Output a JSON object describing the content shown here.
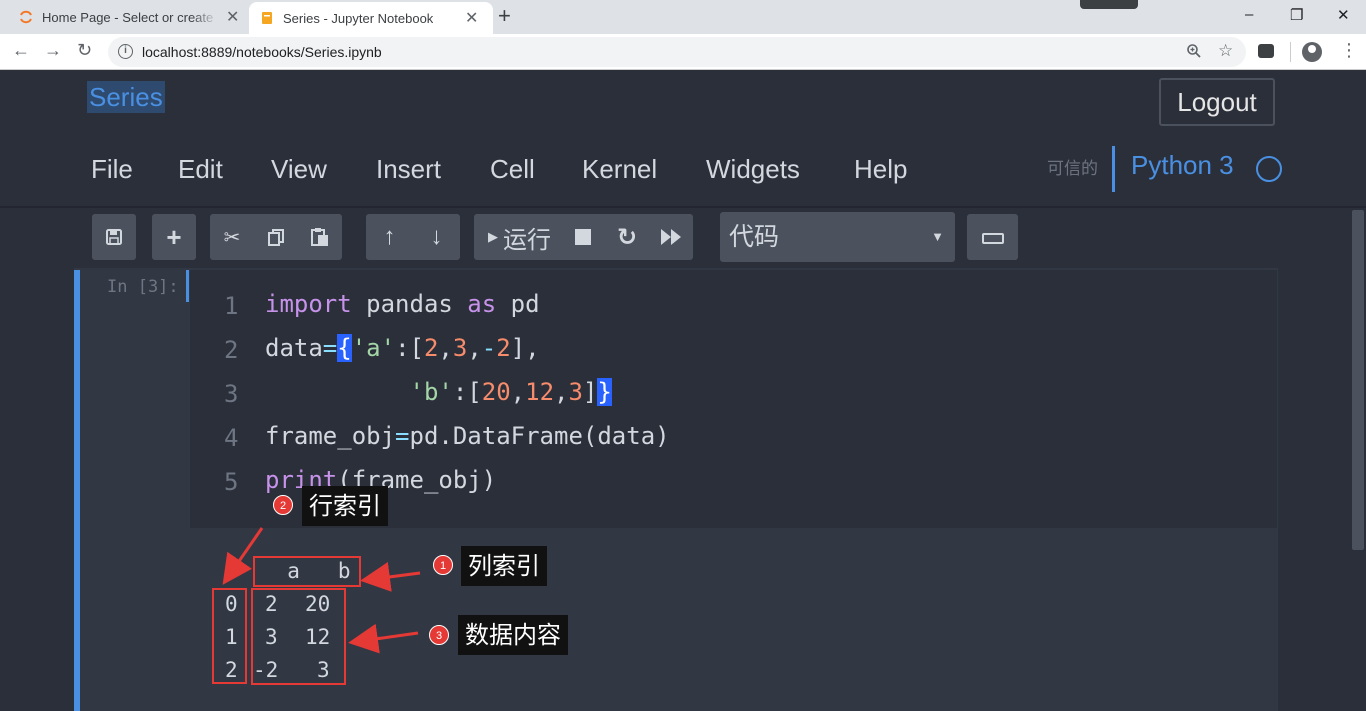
{
  "browser": {
    "tabs": [
      {
        "title": "Home Page - Select or create a notebook",
        "active": false
      },
      {
        "title": "Series - Jupyter Notebook",
        "active": true
      }
    ],
    "new_tab": "+",
    "url": "localhost:8889/notebooks/Series.ipynb",
    "window_controls": {
      "minimize": "–",
      "maximize": "❐",
      "close": "✕"
    }
  },
  "notebook": {
    "title": "Series",
    "logout_label": "Logout",
    "menu": [
      "File",
      "Edit",
      "View",
      "Insert",
      "Cell",
      "Kernel",
      "Widgets",
      "Help"
    ],
    "trusted": "可信的",
    "kernel_name": "Python 3",
    "toolbar": {
      "run_label": "运行",
      "cell_type": "代码"
    },
    "cell": {
      "prompt": "In [3]:",
      "line_numbers": [
        "1",
        "2",
        "3",
        "4",
        "5"
      ],
      "output": {
        "header": "  a   b",
        "rows": [
          {
            "index": "0",
            "a": "2",
            "b": "20"
          },
          {
            "index": "1",
            "a": "3",
            "b": "12"
          },
          {
            "index": "2",
            "a": "-2",
            "b": "3"
          }
        ]
      }
    }
  },
  "annotations": {
    "column_index": {
      "badge": "1",
      "label": "列索引"
    },
    "row_index": {
      "badge": "2",
      "label": "行索引"
    },
    "data_content": {
      "badge": "3",
      "label": "数据内容"
    }
  },
  "colors": {
    "accent": "#4a90e2",
    "background": "#2b2f3a",
    "annotation_red": "#e53935"
  },
  "icons": [
    "save-icon",
    "add-icon",
    "cut-icon",
    "copy-icon",
    "paste-icon",
    "move-up-icon",
    "move-down-icon",
    "run-icon",
    "stop-icon",
    "restart-icon",
    "fast-forward-icon",
    "keyboard-icon"
  ]
}
